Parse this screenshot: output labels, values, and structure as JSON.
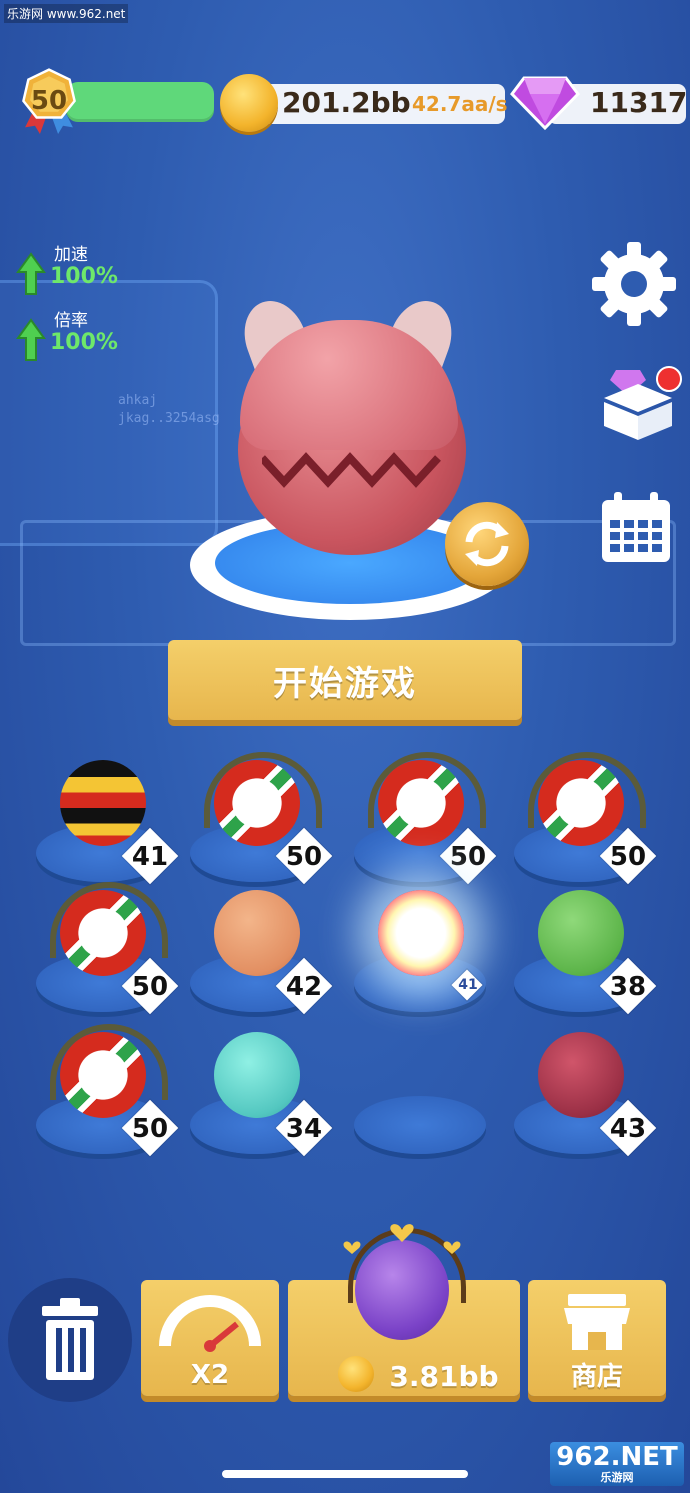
{
  "watermark_top": "乐游网 www.962.net",
  "header": {
    "level": "50",
    "coins": "201.2bb",
    "coin_rate": "42.7aa/s",
    "gems": "11317"
  },
  "boosts": [
    {
      "label": "加速",
      "value": "100%"
    },
    {
      "label": "倍率",
      "value": "100%"
    }
  ],
  "hud_text": [
    "ahkaj",
    "jkag..3254asg"
  ],
  "start_button": "开始游戏",
  "grid": [
    {
      "ball": "uganda-flag-ball",
      "level": "41"
    },
    {
      "ball": "burundi-headphones-ball",
      "level": "50"
    },
    {
      "ball": "burundi-headphones-ball",
      "level": "50"
    },
    {
      "ball": "burundi-headphones-ball",
      "level": "50"
    },
    {
      "ball": "burundi-headphones-ball",
      "level": "50"
    },
    {
      "ball": "bow-face-ball",
      "level": "42"
    },
    {
      "ball": "glowing-ball",
      "level": "41"
    },
    {
      "ball": "green-sunglasses-ball",
      "level": "38"
    },
    {
      "ball": "burundi-headphones-ball",
      "level": "50"
    },
    {
      "ball": "teal-hat-ball",
      "level": "34"
    },
    {
      "ball": "empty",
      "level": ""
    },
    {
      "ball": "red-cap-ball",
      "level": "43"
    }
  ],
  "bottom": {
    "speed_label": "X2",
    "buy_price": "3.81bb",
    "shop_label": "商店"
  },
  "watermark_bottom": {
    "main": "962.NET",
    "sub": "乐游网"
  },
  "colors": {
    "accent_gold": "#e7b64d",
    "level_bar": "#5fd87a",
    "bg": "#2e5cb0"
  }
}
